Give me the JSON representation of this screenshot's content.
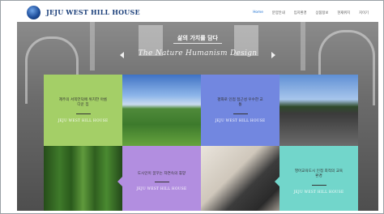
{
  "header": {
    "logo_text": "JEJU WEST HILL HOUSE",
    "nav": [
      "Home",
      "분양안내",
      "입지환경",
      "상품정보",
      "현재위치",
      "지이기"
    ]
  },
  "hero": {
    "headline": "삶의 가치를 담다",
    "subtitle": "The Nature Humanism Design"
  },
  "tiles": [
    {
      "text": "제주의 서쪽언덕에 위치한 아름다운 집",
      "brand": "JEJU WEST HILL HOUSE"
    },
    {
      "text": "평화로 인접 접근성 우수한 교통",
      "brand": "JEJU WEST HILL HOUSE"
    },
    {
      "text": "도시인이 꿈꾸는 자연속의 휴양",
      "brand": "JEJU WEST HILL HOUSE"
    },
    {
      "text": "영어교육도시 인접 최적의 교육환경",
      "brand": "JEJU WEST HILL HOUSE"
    }
  ],
  "colors": {
    "green": "#a4cf67",
    "blue": "#7287e0",
    "purple": "#b28ee0",
    "teal": "#72d6cb",
    "logo": "#1b3f7a",
    "nav_active": "#1b6fd1"
  }
}
